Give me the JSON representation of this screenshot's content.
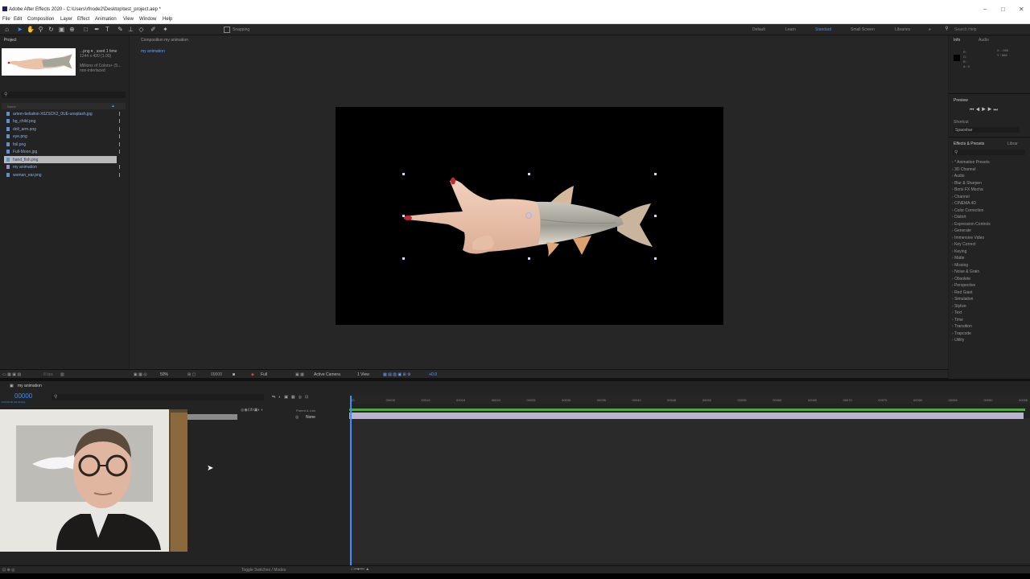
{
  "window": {
    "title": "Adobe After Effects 2020 - C:\\Users\\rfnode2\\Desktop\\test_project.aep *",
    "minimize": "–",
    "maximize": "□",
    "close": "✕"
  },
  "menu": [
    "File",
    "Edit",
    "Composition",
    "Layer",
    "Effect",
    "Animation",
    "View",
    "Window",
    "Help"
  ],
  "toolbar": {
    "snapping": "Snapping",
    "workspaces": [
      "Default",
      "Learn",
      "Standard",
      "Small Screen",
      "Libraries"
    ],
    "active_workspace": "Standard",
    "search_placeholder": "Search Help"
  },
  "project": {
    "title": "Project",
    "thumb_name": "...png ▾ , used 1 time",
    "thumb_size": "1244 x 420 (1.00)",
    "thumb_colors": "Millions of Colors+ (S...",
    "thumb_interlace": "non-interlaced",
    "column_name": "Name",
    "items": [
      "artem-beliaikin-X0ZSCK2_0UE-unsplash.jpg",
      "bg_child.png",
      "doll_arm.png",
      "eye.png",
      "foil.png",
      "Full-Moon.jpg",
      "hand_fish.png",
      "my animation",
      "woman_ear.png"
    ],
    "selected_index": 6,
    "bpc": "8 bpc"
  },
  "composition": {
    "tab": "Composition my animation",
    "breadcrumb": "my animation",
    "zoom": "50%",
    "timecode": "00000",
    "resolution": "Full",
    "camera": "Active Camera",
    "views": "1 View",
    "exposure": "+0.0"
  },
  "info": {
    "tab_info": "Info",
    "tab_audio": "Audio",
    "r": "R :",
    "g": "G :",
    "b": "B :",
    "a": "A : 0",
    "x": "X : -946",
    "y": "Y : 668"
  },
  "preview": {
    "title": "Preview",
    "shortcut_label": "Shortcut",
    "shortcut_value": "Spacebar"
  },
  "effects": {
    "tab": "Effects & Presets",
    "tab2": "Librar",
    "categories": [
      "* Animation Presets",
      "3D Channel",
      "Audio",
      "Blur & Sharpen",
      "Boris FX Mocha",
      "Channel",
      "CINEMA 4D",
      "Color Correction",
      "Distort",
      "Expression Controls",
      "Generate",
      "Immersive Video",
      "Key Correct",
      "Keying",
      "Matte",
      "Missing",
      "Noise & Grain",
      "Obsolete",
      "Perspective",
      "Red Giant",
      "Simulation",
      "Stylize",
      "Text",
      "Time",
      "Transition",
      "Trapcode",
      "Utility"
    ]
  },
  "timeline": {
    "tab": "my animation",
    "timecode": "00000",
    "fps": "0:00:00:00 (25.00 fps)",
    "parent_label": "Parent & Link",
    "parent_value": "None",
    "ruler": [
      "00",
      "00005",
      "00010",
      "00015",
      "00020",
      "00025",
      "00030",
      "00035",
      "00040",
      "00045",
      "00050",
      "00055",
      "00060",
      "00065",
      "00070",
      "00075",
      "00080",
      "00085",
      "00090",
      "00095"
    ],
    "toggle": "Toggle Switches / Modes"
  },
  "colors": {
    "accent": "#3d8ef8",
    "work_area": "#4ea83f",
    "layer_bar": "#b7b3d1"
  }
}
